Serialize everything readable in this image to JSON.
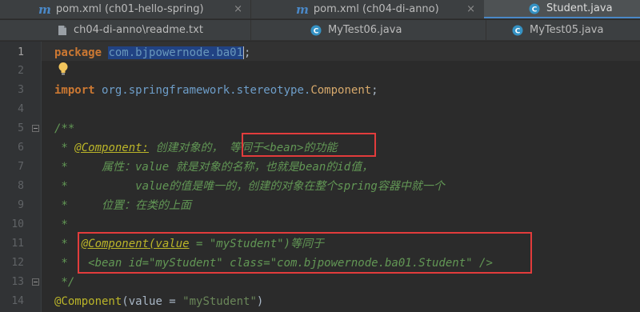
{
  "tabs_row1": [
    {
      "label": "pom.xml (ch01-hello-spring)",
      "icon": "maven-icon",
      "closable": true
    },
    {
      "label": "pom.xml (ch04-di-anno)",
      "icon": "maven-icon",
      "closable": true
    },
    {
      "label": "Student.java",
      "icon": "java-class-icon",
      "closable": false,
      "active": true
    }
  ],
  "tabs_row2": [
    {
      "label": "ch04-di-anno\\readme.txt",
      "icon": "text-file-icon"
    },
    {
      "label": "MyTest06.java",
      "icon": "java-class-icon"
    },
    {
      "label": "MyTest05.java",
      "icon": "java-class-icon"
    }
  ],
  "close_glyph": "×",
  "gutter": {
    "line_numbers": [
      "1",
      "2",
      "3",
      "4",
      "5",
      "6",
      "7",
      "8",
      "9",
      "10",
      "11",
      "12",
      "13",
      "14"
    ],
    "current_line": "1"
  },
  "code": {
    "l1": {
      "kw": "package",
      "pkg": "com.bjpowernode.ba01",
      "semi": ";"
    },
    "l3": {
      "kw": "import",
      "pkg": "org.springframework.stereotype.",
      "cls": "Component",
      "semi": ";"
    },
    "l5": "/**",
    "l6": {
      "star": " * ",
      "ann": "@Component:",
      "text": " 创建对象的， ",
      "boxed": "等同于<bean>的功能"
    },
    "l7": " *     属性：value 就是对象的名称，也就是bean的id值，",
    "l8": " *          value的值是唯一的，创建的对象在整个spring容器中就一个",
    "l9": " *     位置：在类的上面",
    "l10": " *",
    "l11": {
      "star": " *  ",
      "ann": "@Component(value",
      "eq": " = ",
      "val": "\"myStudent\"",
      "rest": ")等同于"
    },
    "l12": " *   <bean id=\"myStudent\" class=\"com.bjpowernode.ba01.Student\" />",
    "l13": " */",
    "l14": {
      "ann": "@Component",
      "open": "(value = ",
      "str": "\"myStudent\"",
      "close": ")"
    }
  },
  "colors": {
    "keyword": "#cc7832",
    "comment": "#629755",
    "annotation": "#bbb529",
    "string": "#6a8759",
    "highlight_box": "#e23c3c",
    "selection": "#214283"
  }
}
